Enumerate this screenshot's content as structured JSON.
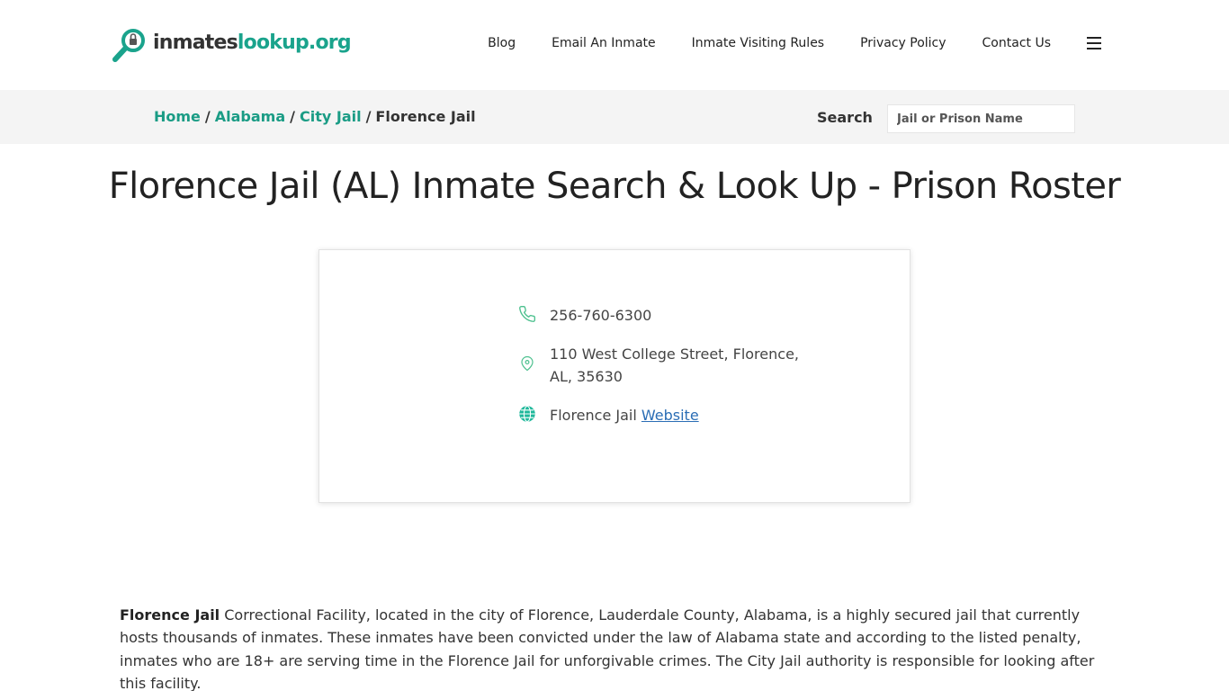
{
  "header": {
    "logo": {
      "part1": "inmates",
      "part2": "lookup.org"
    },
    "nav": [
      {
        "label": "Blog"
      },
      {
        "label": "Email An Inmate"
      },
      {
        "label": "Inmate Visiting Rules"
      },
      {
        "label": "Privacy Policy"
      },
      {
        "label": "Contact Us"
      }
    ],
    "menu_icon": "hamburger-icon"
  },
  "breadcrumb": {
    "items": [
      "Home",
      "Alabama",
      "City Jail"
    ],
    "separator": "/",
    "current": "Florence Jail"
  },
  "search": {
    "label": "Search",
    "placeholder": "Jail or Prison Name"
  },
  "page_title": "Florence Jail (AL) Inmate Search & Look Up - Prison Roster",
  "facility_card": {
    "phone": "256-760-6300",
    "address": "110 West College Street, Florence, AL, 35630",
    "website_prefix": "Florence Jail",
    "website_link": "Website",
    "icons": {
      "phone": "phone-icon",
      "address": "map-pin-icon",
      "website": "globe-icon"
    }
  },
  "description": {
    "bold": "Florence Jail",
    "text": " Correctional Facility, located in the city of Florence, Lauderdale County, Alabama, is a highly secured jail that currently hosts thousands of inmates. These inmates have been convicted under the law of Alabama state and according to the listed penalty, inmates who are 18+ are serving time in the Florence Jail for unforgivable crimes. The City Jail authority is responsible for looking after this facility."
  },
  "colors": {
    "brand": "#1aa38c",
    "link": "#2a6db5",
    "bar": "#f4f4f4"
  }
}
